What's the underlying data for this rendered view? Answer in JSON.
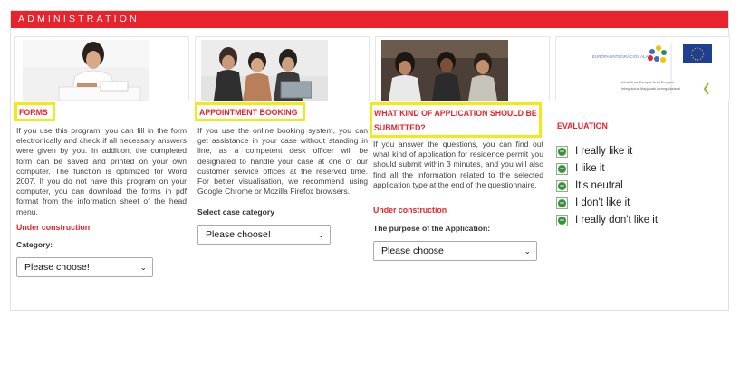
{
  "header": {
    "title": "ADMINISTRATION"
  },
  "forms": {
    "title": "FORMS",
    "description": "If you use this program, you can fill in the form electronically and check if all necessary answers were given by you. In addition, the completed form can be saved and printed on your own computer. The function is optimized for Word 2007. If you do not have this program on your computer, you can download the forms in pdf format from the information sheet of the head menu.",
    "status": "Under construction",
    "select_label": "Category:",
    "select_value": "Please choose!"
  },
  "appointment": {
    "title": "APPOINTMENT BOOKING",
    "description": "If you use the online booking system, you can get assistance in your case without standing in line, as a competent desk officer will be designated to handle your case at one of our customer service offices at the reserved time. For better visualisation, we recommend using Google Chrome or Mozilla Firefox browsers.",
    "select_label": "Select case category",
    "select_value": "Please choose!"
  },
  "application": {
    "title_line1": "WHAT KIND OF APPLICATION SHOULD BE",
    "title_line2": "SUBMITTED?",
    "description": "If you answer the questions, you can find out what kind of application for residence permit you should submit within 3 minutes, and you will also find all the information related to the selected application type at the end of the questionnaire.",
    "status": "Under construction",
    "select_label": "The purpose of the Application:",
    "select_value": "Please choose"
  },
  "eu_logo": {
    "fund_text": "EURÓPAI INTEGRÁCIÓS ALAP",
    "caption_line1": "Készült az Európai Unió Európai",
    "caption_line2": "Integrációs Alapjának támogatásával"
  },
  "evaluation": {
    "title": "EVALUATION",
    "options": [
      "I really like it",
      "I like it",
      "It's neutral",
      "I don't like it",
      "I really don't like it"
    ]
  }
}
